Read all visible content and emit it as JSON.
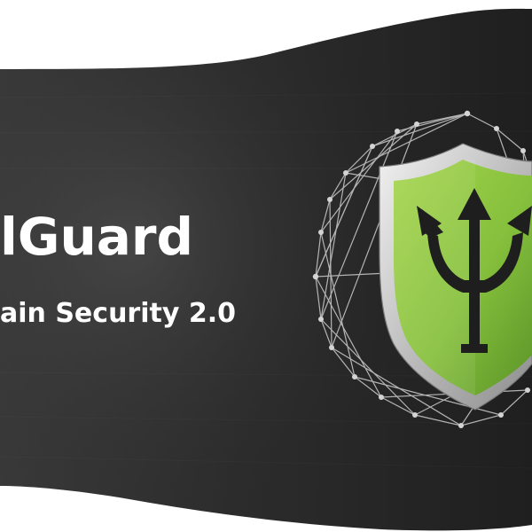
{
  "banner": {
    "title": "lGuard",
    "tagline": "ain Security 2.0"
  },
  "emblem": {
    "icon": "trident-shield-icon",
    "network_icon": "network-mesh-icon"
  },
  "colors": {
    "background_dark": "#2b2b2b",
    "background_light": "#4a4a4a",
    "shield_green": "#8dc63f",
    "shield_green_dark": "#5e9a2a",
    "shield_silver": "#d9d9d9",
    "trident": "#1e1e1e",
    "network_lines": "#bdbdbd",
    "text": "#ffffff"
  }
}
